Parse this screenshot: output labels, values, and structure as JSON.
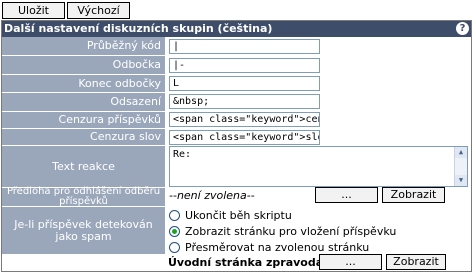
{
  "toolbar": {
    "save": "Uložit",
    "default": "Výchozí"
  },
  "panel": {
    "title": "Další nastavení diskuzních skupin (čeština)",
    "help": "?"
  },
  "fields": [
    {
      "label": "Průběžný kód",
      "value": "|"
    },
    {
      "label": "Odbočka",
      "value": "|-"
    },
    {
      "label": "Konec odbočky",
      "value": "L"
    },
    {
      "label": "Odsazení",
      "value": "&nbsp;"
    },
    {
      "label": "Cenzura příspěvků",
      "value": "<span class=\"keyword\">cenzurov"
    },
    {
      "label": "Cenzura slov",
      "value": "<span class=\"keyword\">slovo cen"
    }
  ],
  "reply": {
    "label": "Text reakce",
    "value": "Re:"
  },
  "unsubscribe": {
    "label": "Předloha pro odhlášení odběru příspěvků",
    "value": "--není zvolena--",
    "browse": "...",
    "show": "Zobrazit"
  },
  "spam": {
    "label": "Je-li příspěvek detekován jako spam",
    "options": [
      {
        "text": "Ukončit běh skriptu",
        "checked": false
      },
      {
        "text": "Zobrazit stránku pro vložení příspěvku",
        "checked": true
      },
      {
        "text": "Přesměrovat na zvolenou stránku",
        "checked": false
      }
    ]
  },
  "news": {
    "label": "Úvodní stránka zpravodajství",
    "browse": "...",
    "show": "Zobrazit"
  }
}
